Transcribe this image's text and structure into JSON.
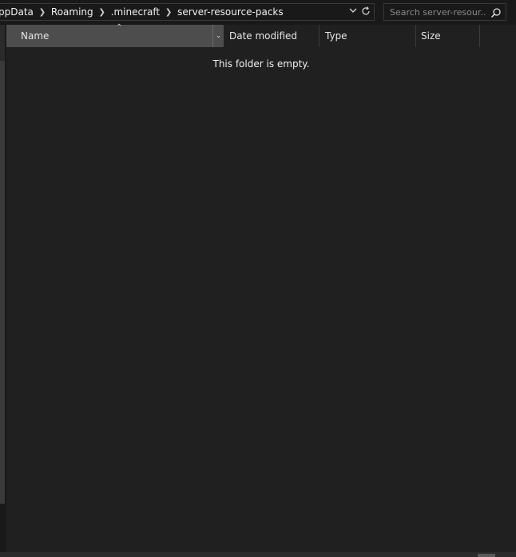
{
  "address": {
    "crumbs": [
      "ppData",
      "Roaming",
      ".minecraft",
      "server-resource-packs"
    ],
    "dropdown_icon": "chevron-down-icon",
    "refresh_icon": "refresh-icon"
  },
  "search": {
    "placeholder": "Search server-resour...",
    "value": ""
  },
  "columns": {
    "name": "Name",
    "date_modified": "Date modified",
    "type": "Type",
    "size": "Size",
    "sort_column": "Name",
    "sort_direction": "ascending"
  },
  "content": {
    "empty_message": "This folder is empty."
  },
  "colors": {
    "background": "#191919",
    "pane": "#202020",
    "selected_header": "#4d4d4d",
    "text": "#f0f0f0"
  }
}
